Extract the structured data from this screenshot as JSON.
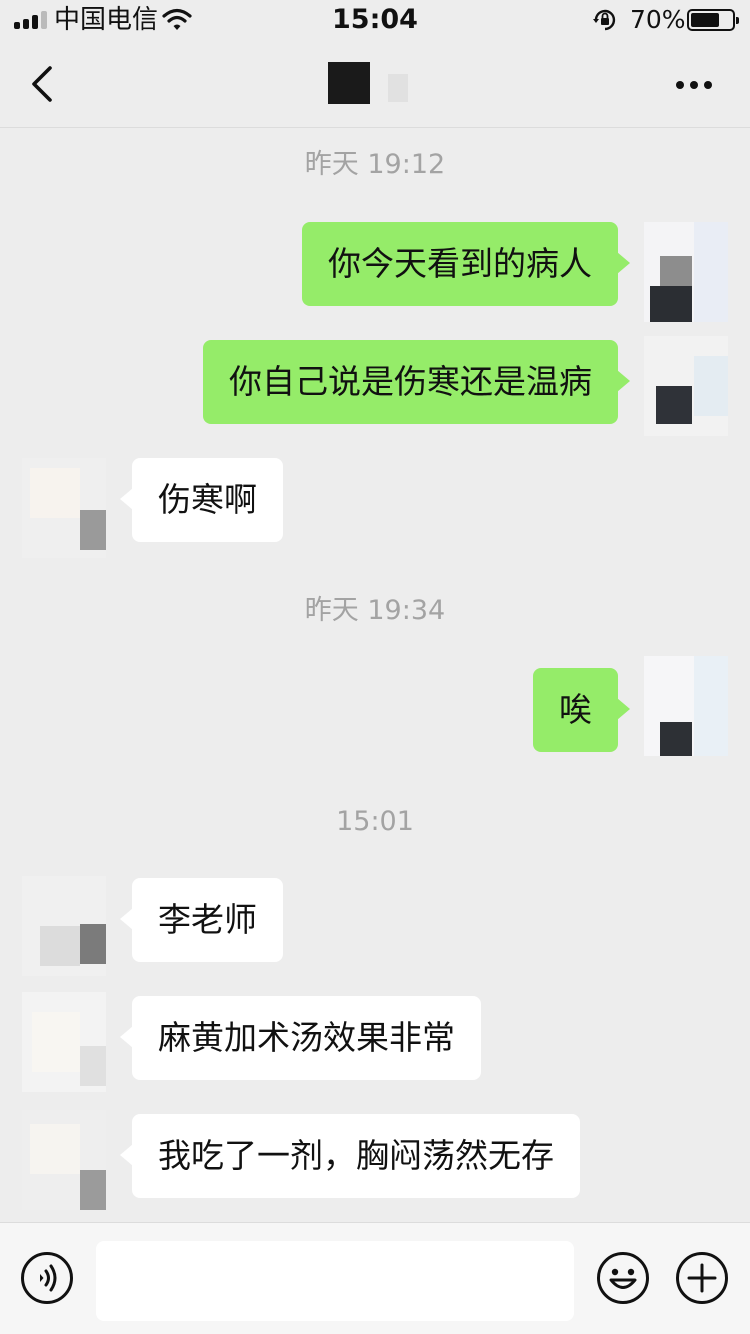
{
  "status_bar": {
    "carrier": "中国电信",
    "time": "15:04",
    "battery_percent": "70%",
    "battery_level": 0.7
  },
  "nav": {
    "back_icon": "chevron-left-icon",
    "more_icon": "more-dots-icon"
  },
  "chat": {
    "timestamps": [
      "昨天 19:12",
      "昨天 19:34",
      "15:01"
    ],
    "messages": [
      {
        "side": "right",
        "text": "你今天看到的病人"
      },
      {
        "side": "right",
        "text": "你自己说是伤寒还是温病"
      },
      {
        "side": "left",
        "text": "伤寒啊"
      },
      {
        "side": "right",
        "text": "唉"
      },
      {
        "side": "left",
        "text": "李老师"
      },
      {
        "side": "left",
        "text": "麻黄加术汤效果非常"
      },
      {
        "side": "left",
        "text": "我吃了一剂，胸闷荡然无存"
      }
    ]
  },
  "input_bar": {
    "voice_icon": "voice-icon",
    "emoji_icon": "emoji-icon",
    "plus_icon": "plus-icon",
    "input_value": ""
  },
  "colors": {
    "background": "#ededed",
    "sent_bubble": "#95ec69",
    "received_bubble": "#ffffff",
    "timestamp_text": "#a3a3a3"
  }
}
